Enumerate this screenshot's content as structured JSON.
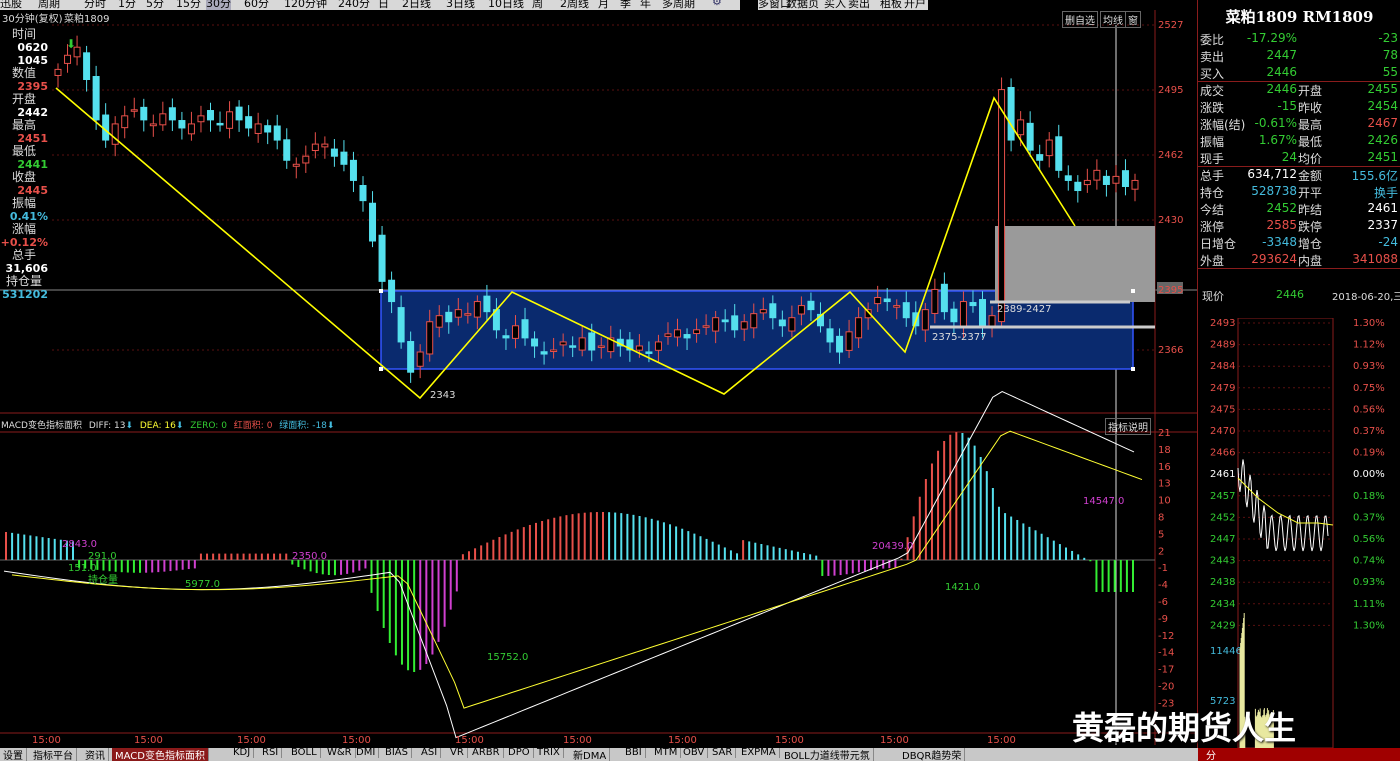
{
  "toolbar": {
    "items": [
      "迅股",
      "周期",
      "分时",
      "1分",
      "5分",
      "15分",
      "30分",
      "60分",
      "120分钟",
      "240分",
      "日",
      "2日线",
      "3日线",
      "10日线",
      "周",
      "2周线",
      "月",
      "季",
      "年",
      "多周期"
    ],
    "active_index": 6,
    "items2": [
      "多窗口",
      "数据页",
      "买入",
      "卖出",
      "租板",
      "开户"
    ]
  },
  "chart_header": {
    "period_label": "30分钟(复权)",
    "symbol": "菜粕1809"
  },
  "info_panel": {
    "rows": [
      {
        "label": "时间",
        "value": "",
        "color": "#ddd"
      },
      {
        "label": "",
        "value": "0620",
        "color": "#fff"
      },
      {
        "label": "",
        "value": "1045",
        "color": "#fff"
      },
      {
        "label": "数值",
        "value": "",
        "color": "#ddd"
      },
      {
        "label": "",
        "value": "2395",
        "color": "#e8504a"
      },
      {
        "label": "开盘",
        "value": "",
        "color": "#ddd"
      },
      {
        "label": "",
        "value": "2442",
        "color": "#fff"
      },
      {
        "label": "最高",
        "value": "",
        "color": "#ddd"
      },
      {
        "label": "",
        "value": "2451",
        "color": "#e8504a"
      },
      {
        "label": "最低",
        "value": "",
        "color": "#ddd"
      },
      {
        "label": "",
        "value": "2441",
        "color": "#3c3"
      },
      {
        "label": "收盘",
        "value": "",
        "color": "#ddd"
      },
      {
        "label": "",
        "value": "2445",
        "color": "#e8504a"
      },
      {
        "label": "振幅",
        "value": "",
        "color": "#ddd"
      },
      {
        "label": "",
        "value": "0.41%",
        "color": "#4bd"
      },
      {
        "label": "涨幅",
        "value": "",
        "color": "#ddd"
      },
      {
        "label": "",
        "value": "+0.12%",
        "color": "#e8504a"
      },
      {
        "label": "总手",
        "value": "",
        "color": "#ddd"
      },
      {
        "label": "",
        "value": "31,606",
        "color": "#fff"
      },
      {
        "label": "持仓量",
        "value": "",
        "color": "#ddd"
      },
      {
        "label": "",
        "value": "531202",
        "color": "#4bd"
      }
    ]
  },
  "price_axis": {
    "labels": [
      "2527",
      "2495",
      "2462",
      "2430",
      "2395",
      "2366"
    ],
    "highlight": "2395"
  },
  "macd_axis": {
    "labels": [
      "21",
      "18",
      "16",
      "13",
      "10",
      "8",
      "5",
      "2",
      "-1",
      "-4",
      "-6",
      "-9",
      "-12",
      "-14",
      "-17",
      "-20",
      "-23"
    ]
  },
  "chart_buttons": {
    "delete_self": "删自选",
    "avg_line": "均线",
    "menu": "窗"
  },
  "annotations": {
    "low_label": "2343",
    "range1": "2389-2427",
    "range2": "2375-2377"
  },
  "macd_header": {
    "name": "MACD变色指标面积",
    "diff": "DIFF: 13",
    "dea": "DEA: 16",
    "zero": "ZERO: 0",
    "red_area": "红面积: 0",
    "green_area": "绿面积: -18",
    "help": "指标说明"
  },
  "macd_values": [
    "2843.0",
    "291.0",
    "2350.0",
    "5977.0",
    "15752.0",
    "20439.0",
    "1421.0",
    "14547.0",
    "151.0"
  ],
  "macd_extra_label": "持仓量",
  "time_axis": {
    "labels": [
      "15:00",
      "15:00",
      "15:00",
      "15:00",
      "15:00",
      "15:00",
      "15:00",
      "15:00",
      "15:00",
      "15:00"
    ]
  },
  "right_panel": {
    "title": "菜粕1809 RM1809",
    "rows": [
      {
        "l": "委比",
        "v": "-17.29%",
        "vc": "#3c3",
        "l2": "",
        "v2": "-23",
        "v2c": "#3c3"
      },
      {
        "l": "卖出",
        "v": "2447",
        "vc": "#3c3",
        "l2": "",
        "v2": "78",
        "v2c": "#3c3"
      },
      {
        "l": "买入",
        "v": "2446",
        "vc": "#3c3",
        "l2": "",
        "v2": "55",
        "v2c": "#3c3"
      },
      {
        "l": "成交",
        "v": "2446",
        "vc": "#3c3",
        "l2": "开盘",
        "v2": "2455",
        "v2c": "#3c3"
      },
      {
        "l": "涨跌",
        "v": "-15",
        "vc": "#3c3",
        "l2": "昨收",
        "v2": "2454",
        "v2c": "#3c3"
      },
      {
        "l": "涨幅(结)",
        "v": "-0.61%",
        "vc": "#3c3",
        "l2": "最高",
        "v2": "2467",
        "v2c": "#e8504a"
      },
      {
        "l": "振幅",
        "v": "1.67%",
        "vc": "#3c3",
        "l2": "最低",
        "v2": "2426",
        "v2c": "#3c3"
      },
      {
        "l": "现手",
        "v": "24",
        "vc": "#3c3",
        "l2": "均价",
        "v2": "2451",
        "v2c": "#3c3"
      },
      {
        "l": "总手",
        "v": "634,712",
        "vc": "#fff",
        "l2": "金额",
        "v2": "155.6亿",
        "v2c": "#4bd"
      },
      {
        "l": "持仓",
        "v": "528738",
        "vc": "#4bd",
        "l2": "开平",
        "v2": "换手",
        "v2c": "#4bd"
      },
      {
        "l": "今结",
        "v": "2452",
        "vc": "#3c3",
        "l2": "昨结",
        "v2": "2461",
        "v2c": "#fff"
      },
      {
        "l": "涨停",
        "v": "2585",
        "vc": "#e8504a",
        "l2": "跌停",
        "v2": "2337",
        "v2c": "#fff"
      },
      {
        "l": "日增仓",
        "v": "-3348",
        "vc": "#4bd",
        "l2": "增仓",
        "v2": "-24",
        "v2c": "#4bd"
      },
      {
        "l": "外盘",
        "v": "293624",
        "vc": "#e8504a",
        "l2": "内盘",
        "v2": "341088",
        "v2c": "#e8504a"
      }
    ],
    "current_price_label": "现价",
    "current_price": "2446",
    "date": "2018-06-20,三",
    "mini_left": [
      "2493",
      "2489",
      "2484",
      "2479",
      "2475",
      "2470",
      "2466",
      "2461",
      "2457",
      "2452",
      "2447",
      "2443",
      "2438",
      "2434",
      "2429",
      "11446",
      "5723"
    ],
    "mini_right": [
      "1.30%",
      "1.12%",
      "0.93%",
      "0.75%",
      "0.56%",
      "0.37%",
      "0.19%",
      "0.00%",
      "0.18%",
      "0.37%",
      "0.56%",
      "0.74%",
      "0.93%",
      "1.11%",
      "1.30%"
    ],
    "bottom_tab": "分"
  },
  "bottom_tabs": [
    "设置",
    "指标平台",
    "资讯",
    "MACD变色指标面积",
    "KDJ",
    "RSI",
    "BOLL",
    "W&R",
    "DMI",
    "BIAS",
    "ASI",
    "VR",
    "ARBR",
    "DPO",
    "TRIX",
    "新DMA",
    "BBI",
    "MTM",
    "OBV",
    "SAR",
    "EXPMA",
    "BOLL力道线带元氛",
    "DBQR趋势荣"
  ],
  "bottom_active": 3,
  "watermark": "黄磊的期货人生",
  "colors": {
    "up": "#e8504a",
    "down": "#55e0ee",
    "zigzag": "#ffff00",
    "box": "#1a3a8a",
    "box_border": "#3355ff",
    "diff": "#ffffff",
    "dea": "#ffff33"
  }
}
